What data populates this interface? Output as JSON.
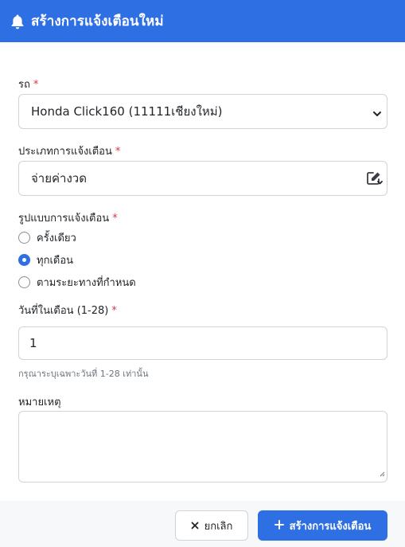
{
  "header": {
    "title": "สร้างการแจ้งเตือนใหม่",
    "icon": "bell-icon"
  },
  "form": {
    "vehicle": {
      "label": "รถ",
      "value": "Honda Click160 (11111เชียงใหม่)"
    },
    "type": {
      "label": "ประเภทการแจ้งเตือน",
      "value": "จ่ายค่างวด"
    },
    "format": {
      "label": "รูปแบบการแจ้งเตือน",
      "options": [
        "ครั้งเดียว",
        "ทุกเดือน",
        "ตามระยะทางที่กำหนด"
      ],
      "selected": "ทุกเดือน"
    },
    "day": {
      "label": "วันที่ในเดือน (1-28)",
      "value": "1",
      "help": "กรุณาระบุเฉพาะวันที่ 1-28 เท่านั้น"
    },
    "note": {
      "label": "หมายเหตุ",
      "value": ""
    },
    "required_mark": "*"
  },
  "footer": {
    "cancel_label": "ยกเลิก",
    "cancel_icon": "close-icon",
    "create_label": "สร้างการแจ้งเตือน",
    "create_icon": "plus-icon"
  },
  "colors": {
    "primary": "#2f6fe4",
    "required": "#dc3545",
    "footer_bg": "#f7f8fa"
  }
}
